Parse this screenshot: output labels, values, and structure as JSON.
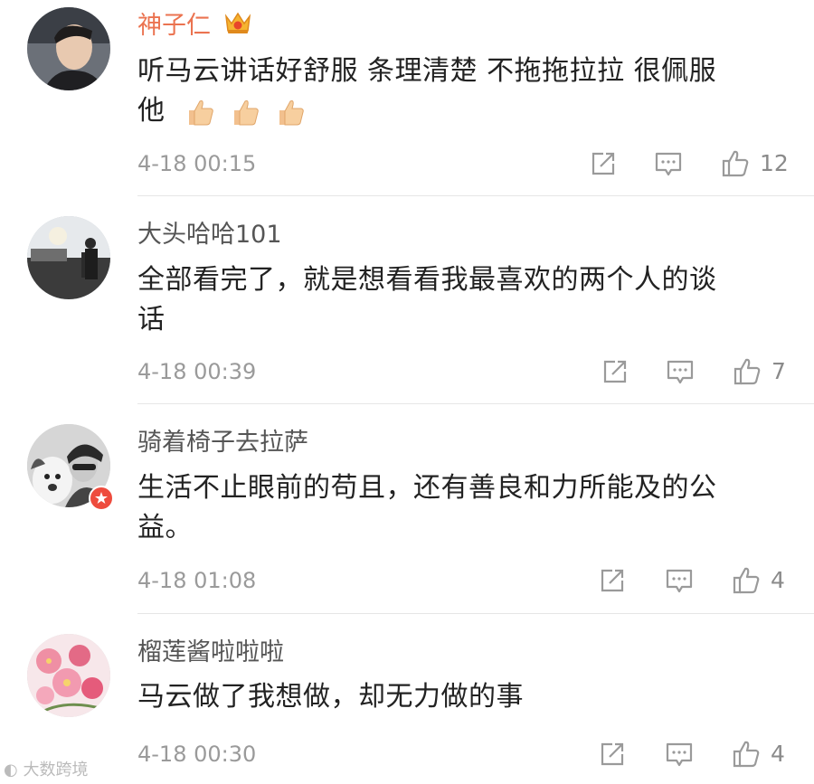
{
  "comments": [
    {
      "username": "神子仁",
      "vip": true,
      "text_line1": "听马云讲话好舒服 条理清楚 不拖拖拉拉 很佩服",
      "text_line2": "他",
      "time": "4-18 00:15",
      "likes": "12",
      "avatar_icon": "avatar-photo"
    },
    {
      "username": "大头哈哈101",
      "vip": false,
      "text_line1": "全部看完了，就是想看看我最喜欢的两个人的谈",
      "text_line2": "话",
      "time": "4-18 00:39",
      "likes": "7",
      "avatar_icon": "avatar-photo"
    },
    {
      "username": "骑着椅子去拉萨",
      "vip": false,
      "text_line1": "生活不止眼前的苟且，还有善良和力所能及的公",
      "text_line2": "益。",
      "time": "4-18 01:08",
      "likes": "4",
      "avatar_icon": "avatar-photo"
    },
    {
      "username": "榴莲酱啦啦啦",
      "vip": false,
      "text_line1": "马云做了我想做，却无力做的事",
      "text_line2": "",
      "time": "4-18 00:30",
      "likes": "4",
      "avatar_icon": "avatar-photo"
    }
  ],
  "icons": {
    "share": "share-icon",
    "reply": "comment-icon",
    "like": "thumbs-up-icon"
  },
  "colors": {
    "vip_name": "#eb7350",
    "name": "#555555",
    "text": "#222222",
    "meta": "#9a9a9a"
  },
  "watermark": "大数跨境"
}
